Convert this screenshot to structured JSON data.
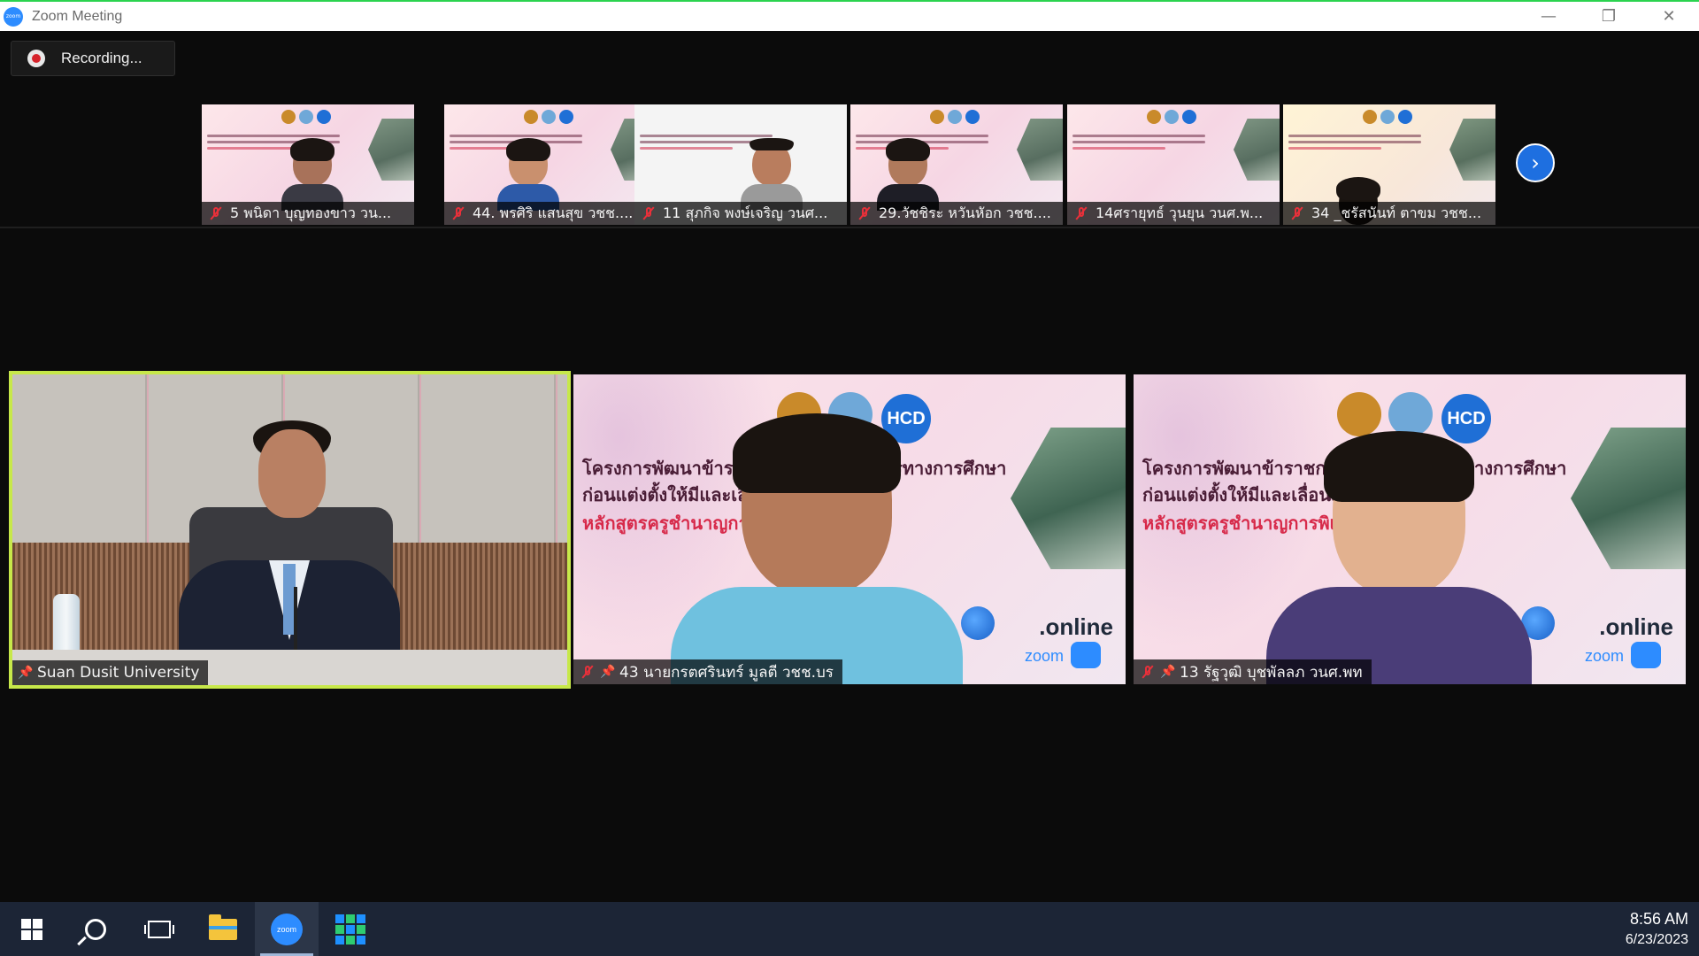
{
  "window": {
    "title": "Zoom Meeting",
    "app_icon": "zoom-logo-icon",
    "controls": [
      "minimize-icon",
      "restore-icon",
      "close-icon"
    ]
  },
  "recording": {
    "label": "Recording...",
    "icon": "recording-dot-icon",
    "color": "#d6232b"
  },
  "thumbnails": [
    {
      "name": "5 พนิดา บุญทองขาว วน...",
      "muted": true
    },
    {
      "name": "44. พรศิริ แสนสุข วชช....",
      "muted": true
    },
    {
      "name": "11 สุภกิจ พงษ์เจริญ วนศ...",
      "muted": true
    },
    {
      "name": "29.วัชชิระ หวันหัอก วชช....",
      "muted": true
    },
    {
      "name": "14ศรายุทธ์ วุนยุน วนศ.พ...",
      "muted": true
    },
    {
      "name": "34 _ชรัสนันท์ ตาขม วชช...",
      "muted": true
    }
  ],
  "next_page": {
    "icon": "chevron-right-icon"
  },
  "main_tiles": [
    {
      "name": "Suan Dusit University",
      "active": true,
      "muted": false,
      "pinned": true
    },
    {
      "name": "43 นายกรตศรินทร์ มูลตี วชช.บร",
      "active": false,
      "muted": true,
      "pinned": true
    },
    {
      "name": "13 รัฐวุฒิ บุชพัลลภ วนศ.พท",
      "active": false,
      "muted": true,
      "pinned": true
    }
  ],
  "banner": {
    "line1": "โครงการพัฒนาข้าราชการครูและบุคลากรทางการศึกษา",
    "line2": "ก่อนแต่งตั้งให้มีและเลื่อนเป็นวิทยฐานะ",
    "line3": "หลักสูตรครูชำนาญการพิเศษ",
    "hcd": "HCD",
    "online": ".online",
    "zoom": "zoom"
  },
  "colors": {
    "active_border": "#c7e84a",
    "mute": "#e8303a",
    "accent": "#1e6fe0",
    "taskbar": "#1c2536"
  },
  "taskbar": {
    "items": [
      {
        "name": "start-button",
        "icon": "windows-icon"
      },
      {
        "name": "search-button",
        "icon": "search-icon"
      },
      {
        "name": "task-view-button",
        "icon": "task-view-icon"
      },
      {
        "name": "file-explorer-button",
        "icon": "folder-icon"
      },
      {
        "name": "zoom-app-button",
        "icon": "zoom-icon",
        "label": "zoom",
        "active": true
      },
      {
        "name": "tiles-app-button",
        "icon": "tiles-icon"
      }
    ],
    "clock": {
      "time": "8:56 AM",
      "date": "6/23/2023"
    }
  }
}
